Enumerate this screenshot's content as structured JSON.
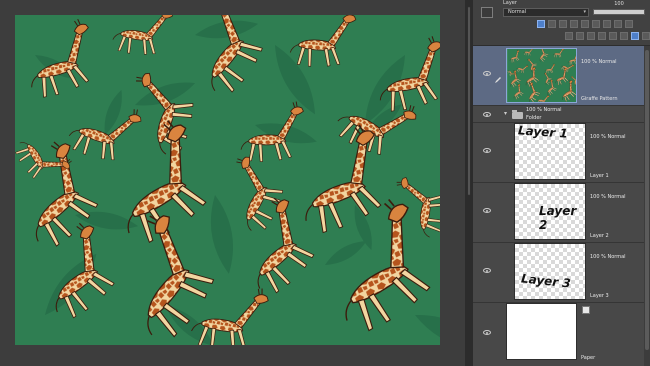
{
  "panel": {
    "tab_label": "Layer",
    "blend_mode": "Normal",
    "opacity_value": "100",
    "opacity_fraction": 1.0,
    "accent": "#4e7fc9",
    "selected_row_color": "#5d6a84"
  },
  "layers": [
    {
      "name": "Giraffe Pattern",
      "props": "100 % Normal",
      "thumb": "pattern"
    },
    {
      "name": "Folder",
      "props": "100 % Normal",
      "thumb": "folder"
    },
    {
      "name": "Layer 1",
      "props": "100 % Normal",
      "thumb": "checker",
      "drawn_text": "Layer 1"
    },
    {
      "name": "Layer 2",
      "props": "100 % Normal",
      "thumb": "checker",
      "drawn_text": "Layer 2"
    },
    {
      "name": "Layer 3",
      "props": "100 % Normal",
      "thumb": "checker",
      "drawn_text": "Layer 3"
    },
    {
      "name": "Paper",
      "props": "",
      "thumb": "white"
    }
  ],
  "canvas": {
    "background_color": "#2f7e52",
    "pattern_subject": "giraffe-pattern"
  }
}
